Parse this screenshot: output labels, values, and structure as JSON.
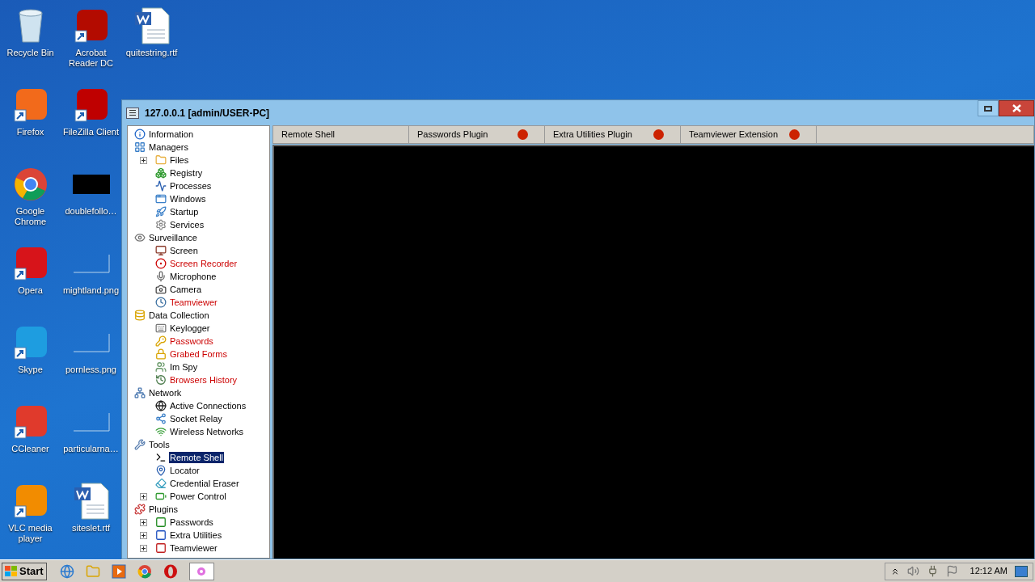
{
  "desktop": {
    "columns": [
      [
        {
          "label": "Recycle Bin",
          "kind": "bin"
        },
        {
          "label": "Firefox",
          "kind": "shortcut",
          "color": "#f26a1b"
        },
        {
          "label": "Google Chrome",
          "kind": "chrome"
        },
        {
          "label": "Opera",
          "kind": "shortcut",
          "color": "#d7141a"
        },
        {
          "label": "Skype",
          "kind": "shortcut",
          "color": "#1e9de0"
        },
        {
          "label": "CCleaner",
          "kind": "shortcut",
          "color": "#e03a2c"
        },
        {
          "label": "VLC media player",
          "kind": "shortcut",
          "color": "#f28c00"
        }
      ],
      [
        {
          "label": "Acrobat Reader DC",
          "kind": "shortcut",
          "color": "#b30b00"
        },
        {
          "label": "FileZilla Client",
          "kind": "shortcut",
          "color": "#bf0000"
        },
        {
          "label": "doublefollo…",
          "kind": "black"
        },
        {
          "label": "mightland.png",
          "kind": "image"
        },
        {
          "label": "pornless.png",
          "kind": "image"
        },
        {
          "label": "particularna…",
          "kind": "image"
        },
        {
          "label": "siteslet.rtf",
          "kind": "document"
        }
      ],
      [
        {
          "label": "quitestring.rtf",
          "kind": "document"
        }
      ]
    ]
  },
  "window": {
    "title": "127.0.0.1 [admin/USER-PC]",
    "tree": [
      {
        "label": "Information",
        "unavailable": false,
        "selected": false
      },
      {
        "label": "Managers",
        "unavailable": false,
        "selected": false,
        "children": [
          {
            "label": "Files",
            "unavailable": false,
            "selected": false,
            "expanded": false
          },
          {
            "label": "Registry",
            "unavailable": false,
            "selected": false
          },
          {
            "label": "Processes",
            "unavailable": false,
            "selected": false
          },
          {
            "label": "Windows",
            "unavailable": false,
            "selected": false
          },
          {
            "label": "Startup",
            "unavailable": false,
            "selected": false
          },
          {
            "label": "Services",
            "unavailable": false,
            "selected": false
          }
        ]
      },
      {
        "label": "Surveillance",
        "unavailable": false,
        "selected": false,
        "children": [
          {
            "label": "Screen",
            "unavailable": false,
            "selected": false
          },
          {
            "label": "Screen Recorder",
            "unavailable": true,
            "selected": false
          },
          {
            "label": "Microphone",
            "unavailable": false,
            "selected": false
          },
          {
            "label": "Camera",
            "unavailable": false,
            "selected": false
          },
          {
            "label": "Teamviewer",
            "unavailable": true,
            "selected": false
          }
        ]
      },
      {
        "label": "Data Collection",
        "unavailable": false,
        "selected": false,
        "children": [
          {
            "label": "Keylogger",
            "unavailable": false,
            "selected": false
          },
          {
            "label": "Passwords",
            "unavailable": true,
            "selected": false
          },
          {
            "label": "Grabed Forms",
            "unavailable": true,
            "selected": false
          },
          {
            "label": "Im Spy",
            "unavailable": false,
            "selected": false
          },
          {
            "label": "Browsers History",
            "unavailable": true,
            "selected": false
          }
        ]
      },
      {
        "label": "Network",
        "unavailable": false,
        "selected": false,
        "children": [
          {
            "label": "Active Connections",
            "unavailable": false,
            "selected": false
          },
          {
            "label": "Socket Relay",
            "unavailable": false,
            "selected": false
          },
          {
            "label": "Wireless Networks",
            "unavailable": false,
            "selected": false
          }
        ]
      },
      {
        "label": "Tools",
        "unavailable": false,
        "selected": false,
        "children": [
          {
            "label": "Remote Shell",
            "unavailable": false,
            "selected": true
          },
          {
            "label": "Locator",
            "unavailable": false,
            "selected": false
          },
          {
            "label": "Credential Eraser",
            "unavailable": false,
            "selected": false
          },
          {
            "label": "Power Control",
            "unavailable": false,
            "selected": false,
            "expanded": false
          }
        ]
      },
      {
        "label": "Plugins",
        "unavailable": false,
        "selected": false,
        "children": [
          {
            "label": "Passwords",
            "unavailable": false,
            "selected": false,
            "expanded": false
          },
          {
            "label": "Extra Utilities",
            "unavailable": false,
            "selected": false,
            "expanded": false
          },
          {
            "label": "Teamviewer",
            "unavailable": false,
            "selected": false,
            "expanded": false
          }
        ]
      }
    ],
    "tabs": [
      {
        "label": "Remote Shell"
      },
      {
        "label": "Passwords Plugin",
        "color": "#cc2200"
      },
      {
        "label": "Extra Utilities Plugin",
        "color": "#cc2200"
      },
      {
        "label": "Teamviewer Extension",
        "color": "#cc2200"
      }
    ]
  },
  "taskbar": {
    "start": "Start",
    "clock": "12:12 AM"
  }
}
